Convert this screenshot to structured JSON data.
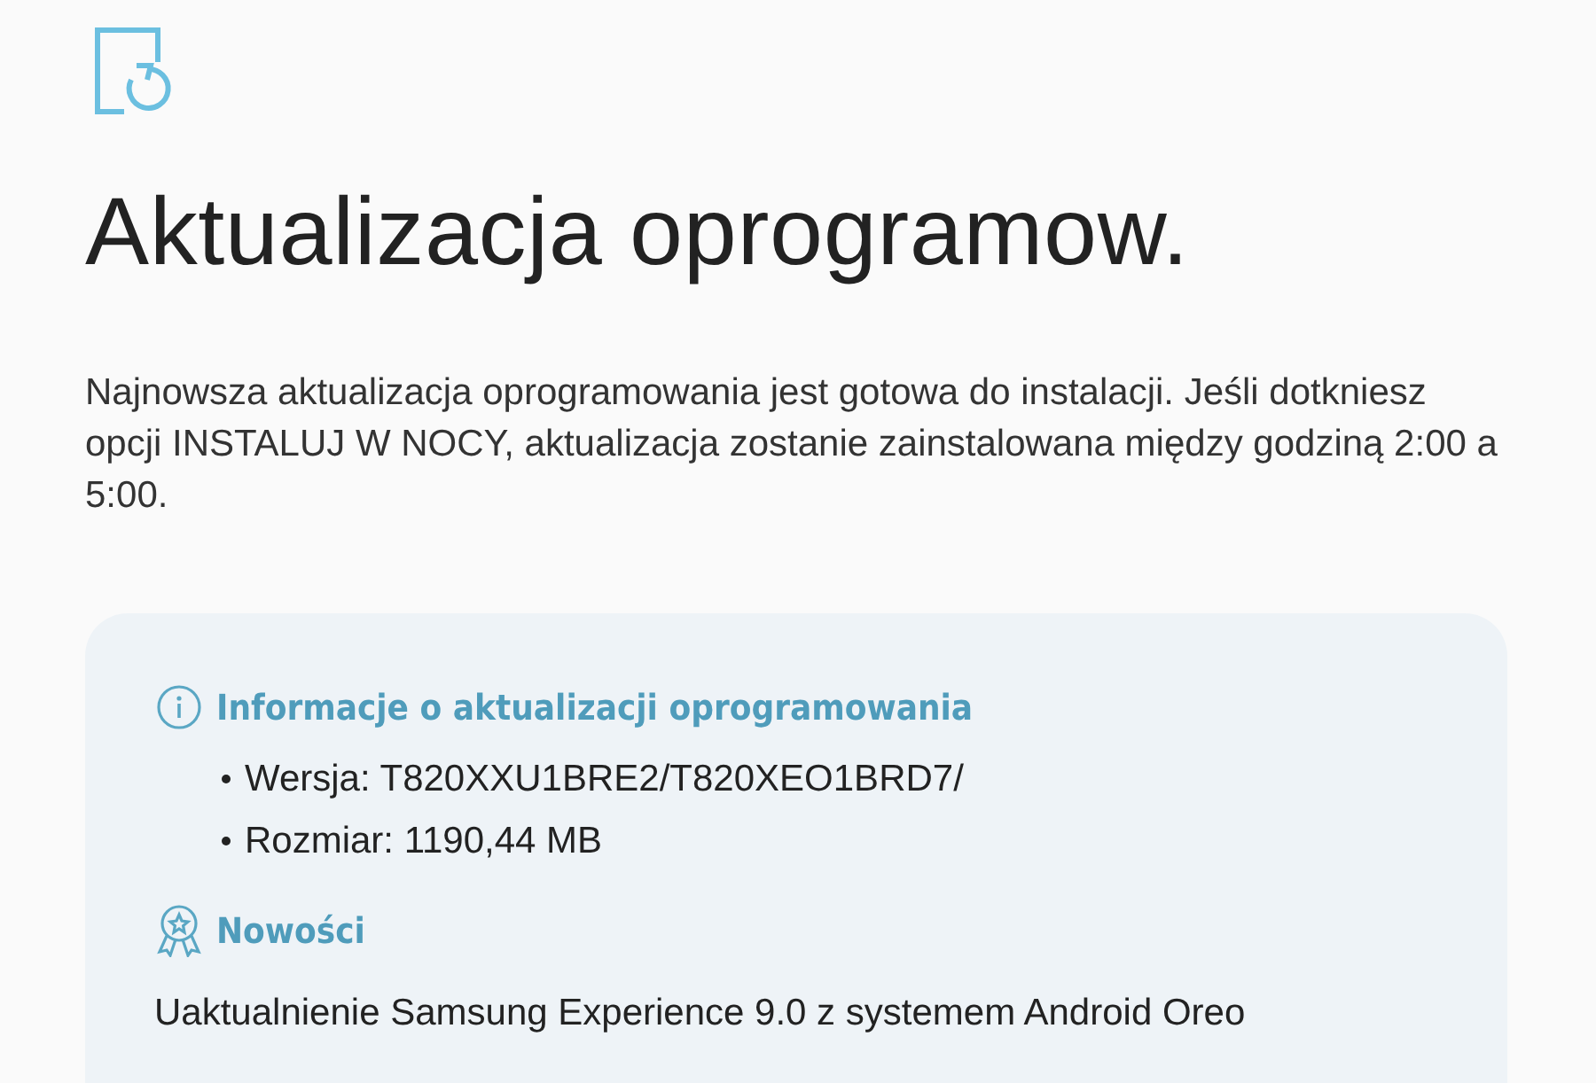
{
  "title": "Aktualizacja oprogramow.",
  "description": "Najnowsza aktualizacja oprogramowania jest gotowa do instalacji. Jeśli dotkniesz opcji INSTALUJ W NOCY, aktualizacja zostanie zainstalowana między godziną 2:00 a 5:00.",
  "info_card": {
    "sections": [
      {
        "kind": "info",
        "heading": "Informacje o aktualizacji oprogramowania",
        "bullets": [
          "Wersja: T820XXU1BRE2/T820XEO1BRD7/",
          "Rozmiar: 1190,44 MB"
        ]
      },
      {
        "kind": "news",
        "heading": "Nowości",
        "text": "Uaktualnienie Samsung Experience 9.0 z systemem Android Oreo"
      }
    ]
  }
}
